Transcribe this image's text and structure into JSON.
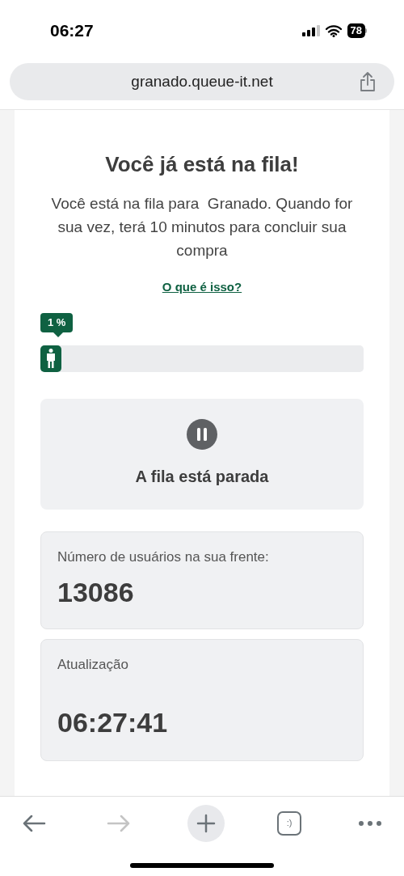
{
  "status_bar": {
    "time": "06:27",
    "battery": "78"
  },
  "address_bar": {
    "url": "granado.queue-it.net"
  },
  "page": {
    "title": "Você já está na fila!",
    "intro": "Você está na fila para  Granado. Quando for sua vez, terá 10 minutos para concluir sua compra",
    "help_link": "O que é isso?",
    "progress": {
      "label": "1 %",
      "level": 0.01
    },
    "status": {
      "kind": "paused",
      "text": "A fila está parada"
    },
    "info_cards": [
      {
        "label": "Número de usuários na sua frente:",
        "value": "13086"
      },
      {
        "label": "Atualização",
        "value": "06:27:41"
      }
    ]
  },
  "toolbar": [
    {
      "kind": "back",
      "disabled": false
    },
    {
      "kind": "forward",
      "disabled": true
    },
    {
      "kind": "new_tab",
      "disabled": false
    },
    {
      "kind": "tabs",
      "label": ":)",
      "disabled": false
    },
    {
      "kind": "more",
      "disabled": false
    }
  ]
}
